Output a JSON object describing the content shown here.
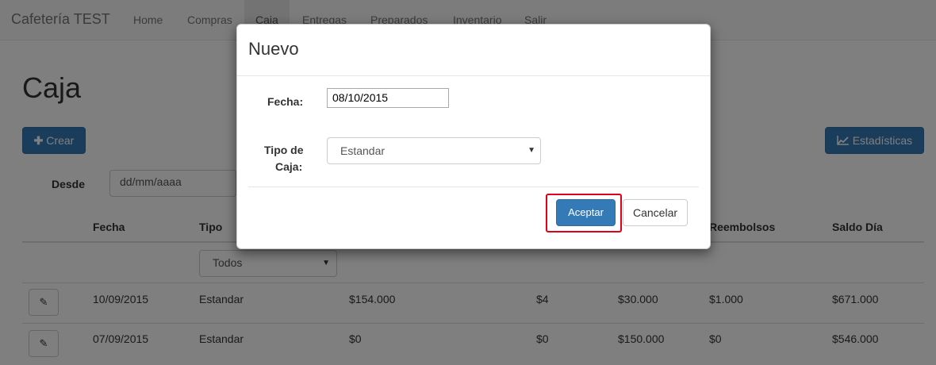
{
  "navbar": {
    "brand": "Cafetería TEST",
    "items": [
      "Home",
      "Compras",
      "Caja",
      "Entregas",
      "Preparados",
      "Inventario",
      "Salir"
    ]
  },
  "page": {
    "title": "Caja",
    "create_label": "Crear",
    "stats_label": "Estadísticas",
    "desde_label": "Desde",
    "desde_placeholder": "dd/mm/aaaa"
  },
  "table": {
    "headers": [
      "Fecha",
      "Tipo",
      "Reembolsos",
      "Saldo Día"
    ],
    "filter_tipo": "Todos",
    "rows": [
      [
        "10/09/2015",
        "Estandar",
        "$154.000",
        "$4",
        "$30.000",
        "$1.000",
        "$671.000"
      ],
      [
        "07/09/2015",
        "Estandar",
        "$0",
        "$0",
        "$150.000",
        "$0",
        "$546.000"
      ]
    ]
  },
  "modal": {
    "title": "Nuevo",
    "fecha_label": "Fecha:",
    "fecha_value": "08/10/2015",
    "tipo_label_1": "Tipo de",
    "tipo_label_2": "Caja:",
    "tipo_value": "Estandar",
    "accept_label": "Aceptar",
    "cancel_label": "Cancelar"
  },
  "colors": {
    "primary": "#337ab7",
    "highlight": "#e0001a"
  },
  "icons": [
    "plus-icon",
    "chart-icon",
    "pencil-icon",
    "caret-down-icon"
  ]
}
